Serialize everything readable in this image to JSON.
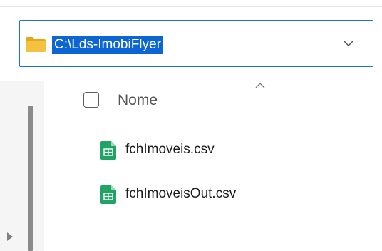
{
  "address_bar": {
    "path": "C:\\Lds-ImobiFlyer",
    "folder_icon": "folder-icon",
    "dropdown_icon": "chevron-down-icon"
  },
  "file_list": {
    "columns": [
      {
        "label": "Nome",
        "sort": "ascending"
      }
    ],
    "files": [
      {
        "name": "fchImoveis.csv",
        "icon": "csv-file-icon"
      },
      {
        "name": "fchImoveisOut.csv",
        "icon": "csv-file-icon"
      }
    ]
  },
  "colors": {
    "accent": "#1a73d9",
    "selection": "#0b66d4",
    "folder": "#f4c241",
    "csv_icon": "#21a366"
  }
}
